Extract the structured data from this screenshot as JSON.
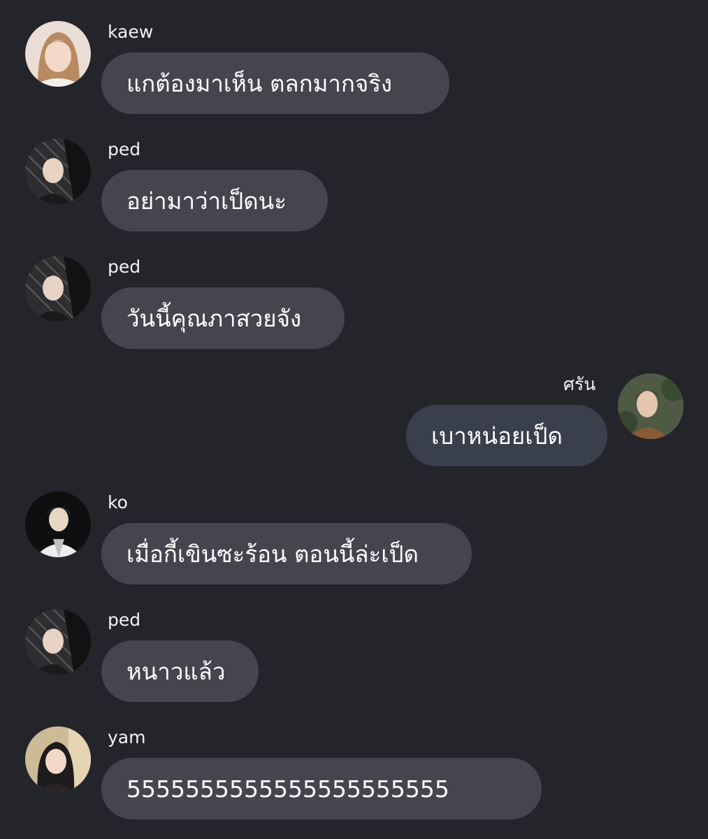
{
  "theme": {
    "background": "#24252b",
    "bubble_incoming": "#45464d",
    "bubble_outgoing": "#3a3f4c",
    "text": "#ffffff"
  },
  "messages": [
    {
      "sender": "kaew",
      "text": "แกต้องมาเห็น ตลกมากจริง",
      "direction": "incoming"
    },
    {
      "sender": "ped",
      "text": "อย่ามาว่าเป็ดนะ",
      "direction": "incoming"
    },
    {
      "sender": "ped",
      "text": "วันนี้คุณภาสวยจัง",
      "direction": "incoming"
    },
    {
      "sender": "ศรัน",
      "text": "เบาหน่อยเป็ด",
      "direction": "outgoing"
    },
    {
      "sender": "ko",
      "text": "เมื่อกี้เขินซะร้อน ตอนนี้ล่ะเป็ด",
      "direction": "incoming"
    },
    {
      "sender": "ped",
      "text": "หนาวแล้ว",
      "direction": "incoming"
    },
    {
      "sender": "yam",
      "text": "5555555555555555555555",
      "direction": "incoming"
    }
  ]
}
